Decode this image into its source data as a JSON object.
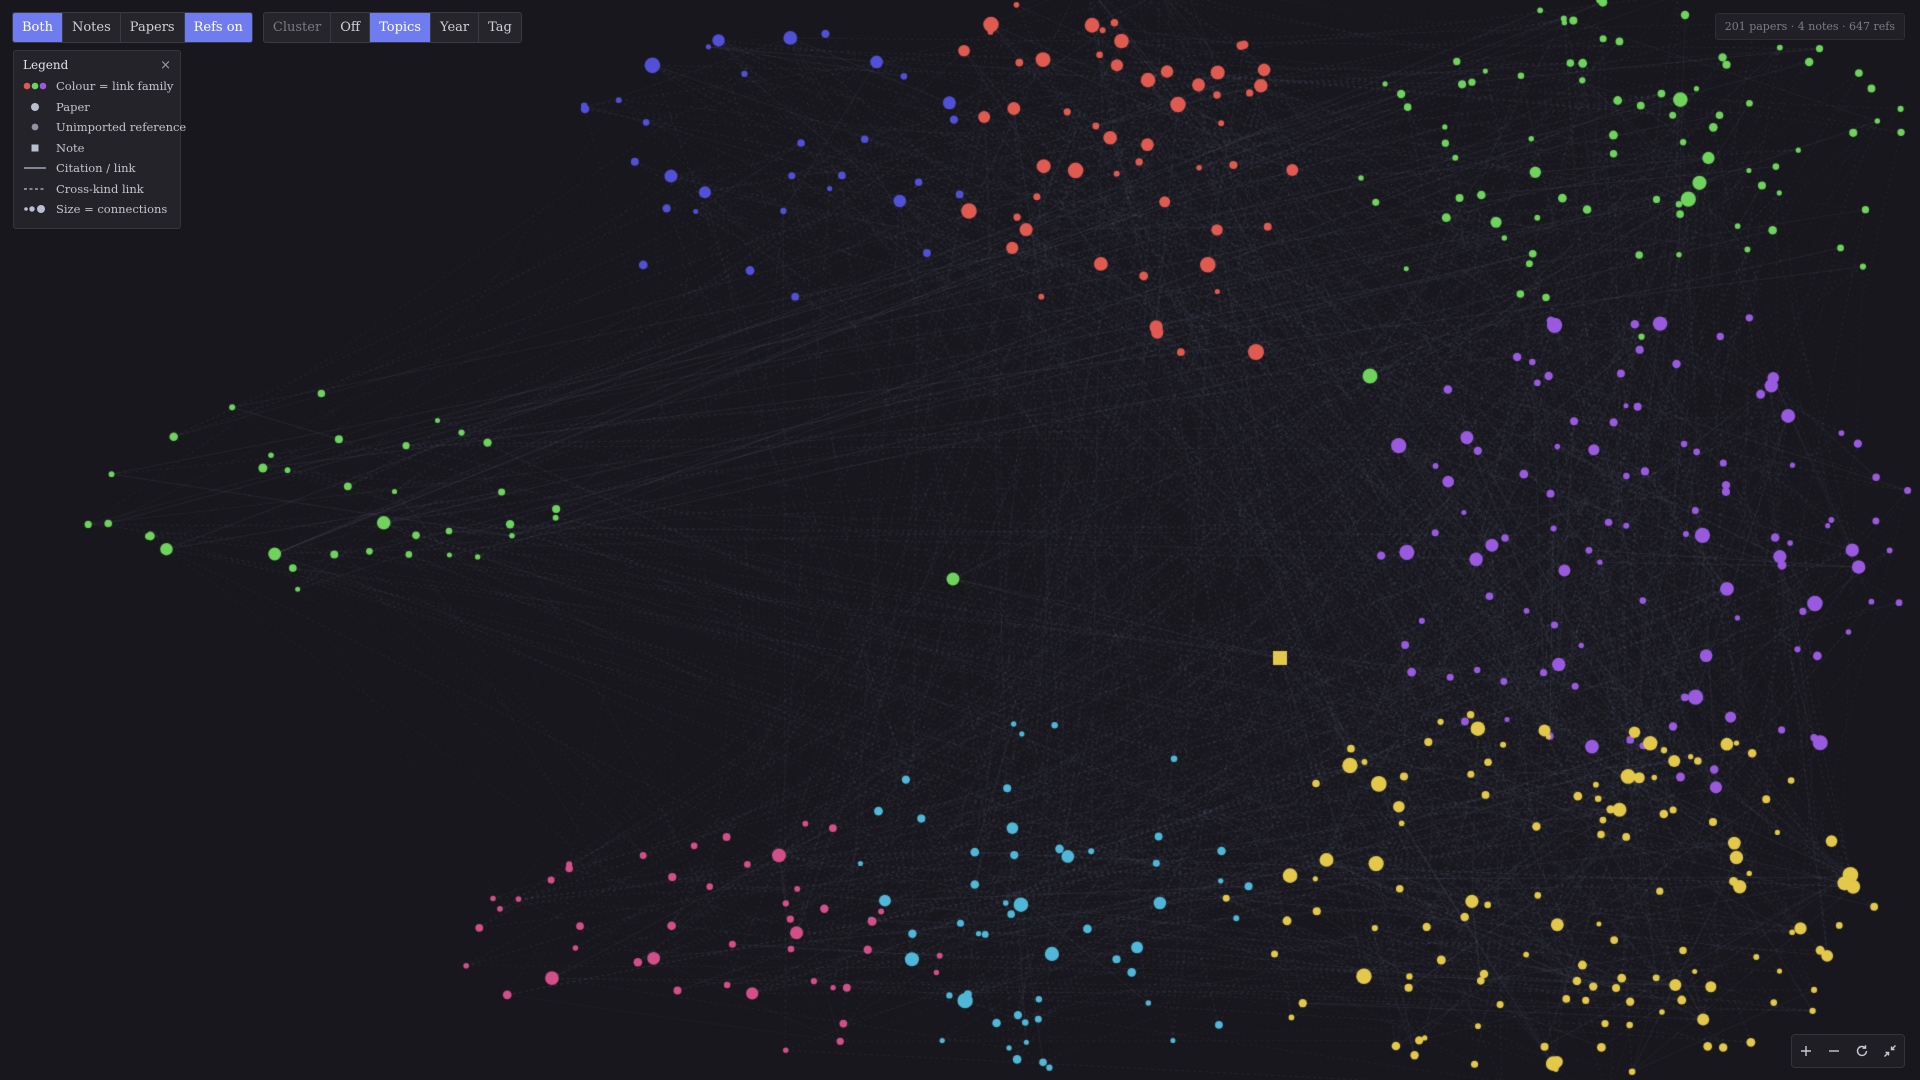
{
  "view_toggle": {
    "both": "Both",
    "notes": "Notes",
    "papers": "Papers",
    "refs": "Refs on"
  },
  "layout_toggle": {
    "cluster": "Cluster",
    "off": "Off",
    "topics": "Topics",
    "year": "Year",
    "tag": "Tag"
  },
  "legend": {
    "title": "Legend",
    "close": "×",
    "items": [
      "Colour = link family",
      "Paper",
      "Unimported reference",
      "Note",
      "Citation / link",
      "Cross-kind link",
      "Size = connections"
    ]
  },
  "stats": "201 papers · 4 notes · 647 refs",
  "colors": {
    "background": "#18171d",
    "accent": "#6f7cf0",
    "red": "#e05a50",
    "green": "#6ed45c",
    "blue": "#5150d8",
    "purple": "#9a5ae0",
    "cyan": "#4fb8d8",
    "pink": "#d44f8a",
    "yellow": "#e3c84a",
    "edge": "#6c7290"
  },
  "icons": {
    "zoom_in": "plus-icon",
    "zoom_out": "minus-icon",
    "reset": "refresh-icon",
    "fit": "collapse-icon"
  }
}
